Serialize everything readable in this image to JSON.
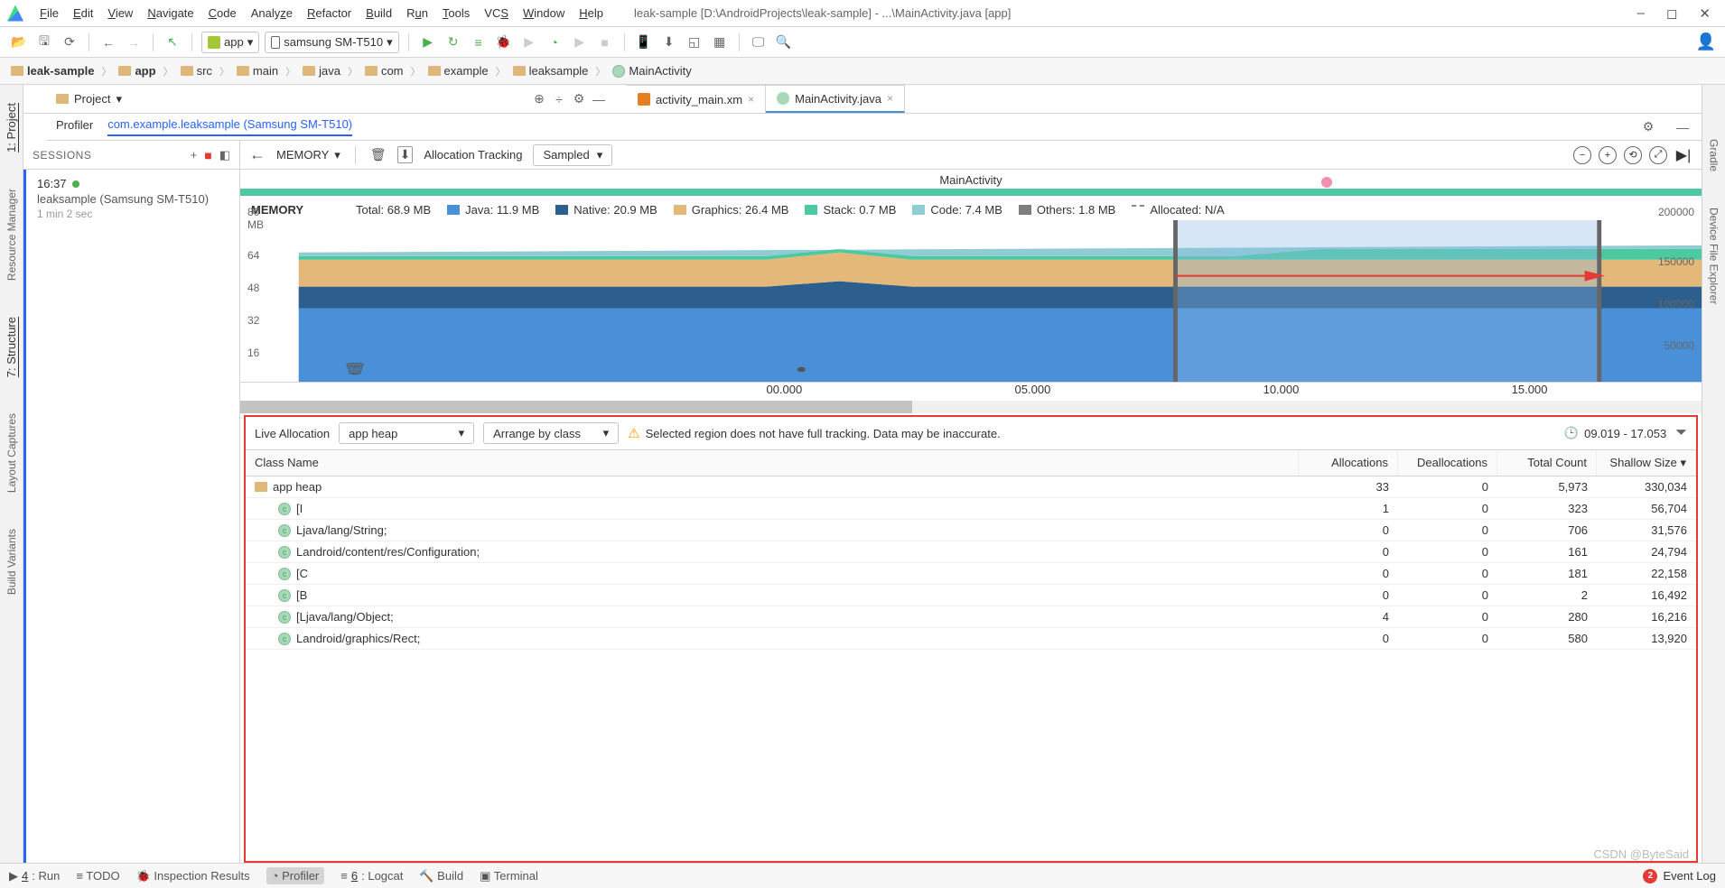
{
  "window": {
    "title": "leak-sample [D:\\AndroidProjects\\leak-sample] - ...\\MainActivity.java [app]"
  },
  "menu": {
    "items": [
      "File",
      "Edit",
      "View",
      "Navigate",
      "Code",
      "Analyze",
      "Refactor",
      "Build",
      "Run",
      "Tools",
      "VCS",
      "Window",
      "Help"
    ]
  },
  "runcfg": {
    "app": "app",
    "device": "samsung SM-T510"
  },
  "breadcrumbs": [
    "leak-sample",
    "app",
    "src",
    "main",
    "java",
    "com",
    "example",
    "leaksample",
    "MainActivity"
  ],
  "topstrip": {
    "view": "Project",
    "tabs": [
      {
        "name": "activity_main.xm",
        "type": "xml"
      },
      {
        "name": "MainActivity.java",
        "type": "class",
        "active": true
      }
    ]
  },
  "profiler": {
    "tab1": "Profiler",
    "tab2": "com.example.leaksample (Samsung SM-T510)"
  },
  "sessions": {
    "heading": "SESSIONS",
    "time": "16:37",
    "device": "leaksample (Samsung SM-T510)",
    "duration": "1 min 2 sec"
  },
  "memtool": {
    "combo": "MEMORY",
    "label": "Allocation Tracking",
    "mode": "Sampled"
  },
  "chart_data": {
    "type": "area",
    "title": "MainActivity",
    "memory_legend": {
      "heading": "MEMORY",
      "total": "Total: 68.9 MB",
      "items": [
        {
          "name": "Java",
          "value": "11.9 MB",
          "color": "#4a90d9"
        },
        {
          "name": "Native",
          "value": "20.9 MB",
          "color": "#2c5f8d"
        },
        {
          "name": "Graphics",
          "value": "26.4 MB",
          "color": "#e3b878"
        },
        {
          "name": "Stack",
          "value": "0.7 MB",
          "color": "#4cc9a1"
        },
        {
          "name": "Code",
          "value": "7.4 MB",
          "color": "#8fccd4"
        },
        {
          "name": "Others",
          "value": "1.8 MB",
          "color": "#7e7e7e"
        },
        {
          "name": "Allocated",
          "value": "N/A",
          "color": "#888",
          "dash": true
        }
      ]
    },
    "y_left": {
      "label": "80 MB",
      "ticks": [
        "64",
        "48",
        "32",
        "16"
      ]
    },
    "y_right": {
      "label": "200000",
      "ticks": [
        "150000",
        "100000",
        "50000"
      ]
    },
    "x_ticks": [
      "00.000",
      "05.000",
      "10.000",
      "15.000"
    ],
    "selection": {
      "start": 0.64,
      "end": 0.93
    }
  },
  "alloc": {
    "label": "Live Allocation",
    "heap": "app heap",
    "arrange": "Arrange by class",
    "warning": "Selected region does not have full tracking. Data may be inaccurate.",
    "timerange": "09.019 - 17.053",
    "columns": [
      "Class Name",
      "Allocations",
      "Deallocations",
      "Total Count",
      "Shallow Size"
    ],
    "rows": [
      {
        "name": "app heap",
        "icon": "folder",
        "allocs": "33",
        "deallocs": "0",
        "total": "5,973",
        "shallow": "330,034",
        "depth": 0
      },
      {
        "name": "[I",
        "icon": "class",
        "allocs": "1",
        "deallocs": "0",
        "total": "323",
        "shallow": "56,704",
        "depth": 1
      },
      {
        "name": "Ljava/lang/String;",
        "icon": "class",
        "allocs": "0",
        "deallocs": "0",
        "total": "706",
        "shallow": "31,576",
        "depth": 1
      },
      {
        "name": "Landroid/content/res/Configuration;",
        "icon": "class",
        "allocs": "0",
        "deallocs": "0",
        "total": "161",
        "shallow": "24,794",
        "depth": 1
      },
      {
        "name": "[C",
        "icon": "class",
        "allocs": "0",
        "deallocs": "0",
        "total": "181",
        "shallow": "22,158",
        "depth": 1
      },
      {
        "name": "[B",
        "icon": "class",
        "allocs": "0",
        "deallocs": "0",
        "total": "2",
        "shallow": "16,492",
        "depth": 1
      },
      {
        "name": "[Ljava/lang/Object;",
        "icon": "class",
        "allocs": "4",
        "deallocs": "0",
        "total": "280",
        "shallow": "16,216",
        "depth": 1
      },
      {
        "name": "Landroid/graphics/Rect;",
        "icon": "class",
        "allocs": "0",
        "deallocs": "0",
        "total": "580",
        "shallow": "13,920",
        "depth": 1
      }
    ]
  },
  "statusbar": {
    "items": [
      "4: Run",
      "TODO",
      "Inspection Results",
      "Profiler",
      "6: Logcat",
      "Build",
      "Terminal"
    ],
    "eventlog": "Event Log"
  },
  "leftgutter": [
    "1: Project",
    "Resource Manager",
    "7: Structure",
    "Layout Captures",
    "Build Variants"
  ],
  "rightgutter": [
    "Gradle",
    "Device File Explorer"
  ],
  "watermark": "CSDN @ByteSaid"
}
